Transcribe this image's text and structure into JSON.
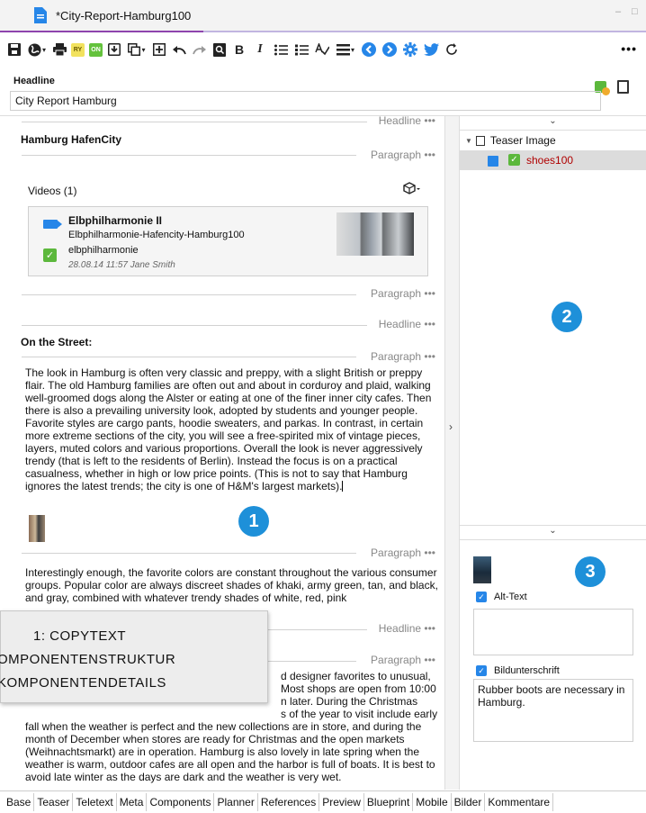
{
  "document_tab": {
    "title": "*City-Report-Hamburg100"
  },
  "window_controls": {
    "minimize": "–",
    "maximize": "□"
  },
  "toolbar": {
    "ry_label": "RY",
    "on_label": "ON",
    "more_label": "•••"
  },
  "headline_field": {
    "label": "Headline",
    "value": "City Report Hamburg"
  },
  "editor": {
    "labels": {
      "headline": "Headline •••",
      "paragraph": "Paragraph •••"
    },
    "heading_1": "Hamburg HafenCity",
    "videos_title": "Videos (1)",
    "video": {
      "title": "Elbphilharmonie II",
      "subtitle": "Elbphilharmonie-Hafencity-Hamburg100",
      "name": "elbphilharmonie",
      "meta": "28.08.14 11:57 Jane Smith"
    },
    "heading_2": "On the Street:",
    "para_1": "The look in Hamburg is often very classic and preppy, with a slight British or preppy flair.  The old Hamburg families are often out and about in corduroy and plaid, walking well-groomed dogs along the Alster or eating at one of the finer inner city cafes.  Then there is also a prevailing university look, adopted by students and younger people.  Favorite styles are cargo pants, hoodie sweaters, and parkas.  In contrast, in certain more extreme sections of the city, you will see a free-spirited mix of vintage pieces, layers, muted colors and various proportions.  Overall the look is never aggressively trendy (that is left to the residents of Berlin).  Instead the focus is on a practical casualness, whether in high or low price points.  (This is not to say that Hamburg ignores the latest trends; the city is one of H&M's largest markets).",
    "para_2": "Interestingly enough, the favorite colors are constant throughout the various consumer groups.  Popular color are always discreet shades of khaki, army green, tan, and black, and gray, combined with whatever trendy shades of white, red, pink",
    "para_3_lines": [
      "d designer favorites to unusual,",
      "Most shops are open from 10:00",
      "n later.  During the Christmas",
      "s of the year to visit include early"
    ],
    "para_3_rest": "fall when the weather is perfect and the new collections are in store, and during the month of December when stores are ready for Christmas and the open markets (Weihnachtsmarkt) are in operation.  Hamburg is also lovely in late spring when the weather is warm, outdoor cafes are all open and the harbor is full of boats.  It is best to avoid late winter as the days are dark and the weather is very wet."
  },
  "legend": {
    "line_1": "1: COPYTEXT",
    "line_2": "OMPONENTENSTRUKTUR",
    "line_3": "KOMPONENTENDETAILS"
  },
  "badges": {
    "one": "1",
    "two": "2",
    "three": "3"
  },
  "structure_panel": {
    "root_label": "Teaser Image",
    "child_label": "shoes100"
  },
  "details_panel": {
    "alt_label": "Alt-Text",
    "alt_value": "",
    "caption_label": "Bildunterschrift",
    "caption_value": "Rubber boots are necessary in Hamburg."
  },
  "bottom_tabs": [
    "Base",
    "Teaser",
    "Teletext",
    "Meta",
    "Components",
    "Planner",
    "References",
    "Preview",
    "Blueprint",
    "Mobile",
    "Bilder",
    "Kommentare"
  ]
}
